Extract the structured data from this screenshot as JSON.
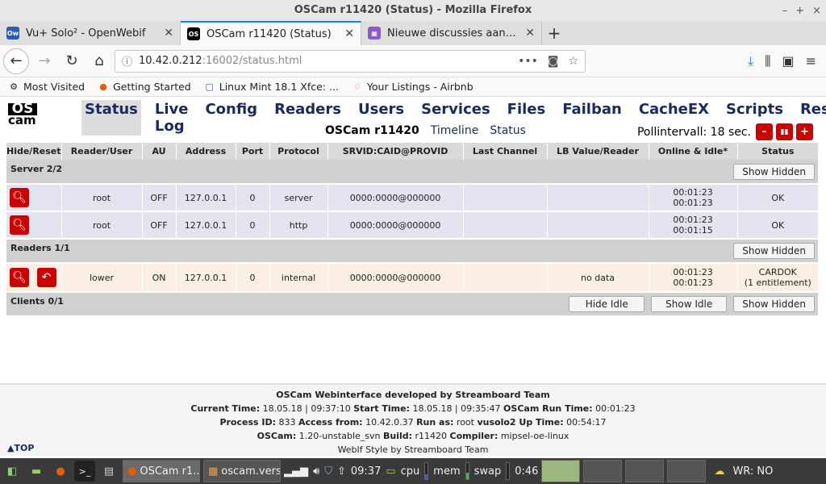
{
  "window": {
    "title": "OSCam r11420 (Status) - Mozilla Firefox",
    "ctrls": [
      "–",
      "+",
      "×"
    ]
  },
  "tabs": [
    {
      "label": "Vu+ Solo² - OpenWebif",
      "fav": "Ow",
      "favcolor": "#2a5db0",
      "active": false
    },
    {
      "label": "OSCam r11420 (Status)",
      "fav": "OS",
      "favcolor": "#000000",
      "active": true
    },
    {
      "label": "Nieuwe discussies aanmaken",
      "fav": "▦",
      "favcolor": "#8a5ec2",
      "active": false
    }
  ],
  "nav": {
    "url_host": "10.42.0.212",
    "url_rest": ":16002/status.html",
    "url_dots": "•••"
  },
  "bookmarks": [
    "Most Visited",
    "Getting Started",
    "Linux Mint 18.1 Xfce: ...",
    "Your Listings - Airbnb"
  ],
  "oscam": {
    "logo_top": "OS",
    "logo_bottom": "cam",
    "menu": [
      "Status",
      "Live Log",
      "Config",
      "Readers",
      "Users",
      "Services",
      "Files",
      "Failban",
      "CacheEX",
      "Scripts",
      "Restart"
    ],
    "subtitle": "OSCam r11420",
    "timeline": "Timeline",
    "status_link": "Status",
    "poll": "Pollintervall: 18 sec.",
    "poll_buttons": [
      "–",
      "▮▮",
      "+"
    ]
  },
  "table": {
    "headers": [
      "Hide/Reset",
      "Reader/User",
      "AU",
      "Address",
      "Port",
      "Protocol",
      "SRVID:CAID@PROVID",
      "Last Channel",
      "LB Value/Reader",
      "Online & Idle*",
      "Status"
    ],
    "server_group": "Server 2/2",
    "readers_group": "Readers 1/1",
    "clients_group": "Clients 0/1",
    "show_hidden": "Show Hidden",
    "hide_idle": "Hide Idle",
    "show_idle": "Show Idle",
    "servers": [
      {
        "user": "root",
        "au": "OFF",
        "addr": "127.0.0.1",
        "port": "0",
        "proto": "server",
        "srvid": "0000:0000@000000",
        "last": "",
        "lb": "",
        "on1": "00:01:23",
        "on2": "00:01:23",
        "status": "OK"
      },
      {
        "user": "root",
        "au": "OFF",
        "addr": "127.0.0.1",
        "port": "0",
        "proto": "http",
        "srvid": "0000:0000@000000",
        "last": "",
        "lb": "",
        "on1": "00:01:23",
        "on2": "00:01:15",
        "status": "OK"
      }
    ],
    "readers": [
      {
        "user": "lower",
        "au": "ON",
        "addr": "127.0.0.1",
        "port": "0",
        "proto": "internal",
        "srvid": "0000:0000@000000",
        "last": "",
        "lb": "no data",
        "on1": "00:01:23",
        "on2": "00:01:23",
        "status": "CARDOK",
        "status2": "(1 entitlement)"
      }
    ]
  },
  "footer": {
    "line1": "OSCam Webinterface developed by Streamboard Team",
    "current_time_label": "Current Time:",
    "current_time": "18.05.18 | 09:37:10",
    "start_time_label": "Start Time:",
    "start_time": "18.05.18 | 09:35:47",
    "run_time_label": "OSCam Run Time:",
    "run_time": "00:01:23",
    "pid_label": "Process ID:",
    "pid": "833",
    "access_label": "Access from:",
    "access": "10.42.0.37",
    "runas_label": "Run as:",
    "runas": "root",
    "uptime_label": "vusolo2 Up Time:",
    "uptime": "00:54:17",
    "oscam_label": "OSCam:",
    "oscam_ver": "1.20-unstable_svn",
    "build_label": "Build:",
    "build": "r11420",
    "compiler_label": "Compiler:",
    "compiler": "mipsel-oe-linux",
    "style": "WebIf Style by Streamboard Team",
    "totop": "▲TOP"
  },
  "taskbar": {
    "windows": [
      "OSCam r1...",
      "oscam.vers..."
    ],
    "time": "09:37",
    "cpu": "cpu",
    "mem": "mem",
    "swap": "swap",
    "clock2": "0:46",
    "weather": "WR: NO"
  }
}
